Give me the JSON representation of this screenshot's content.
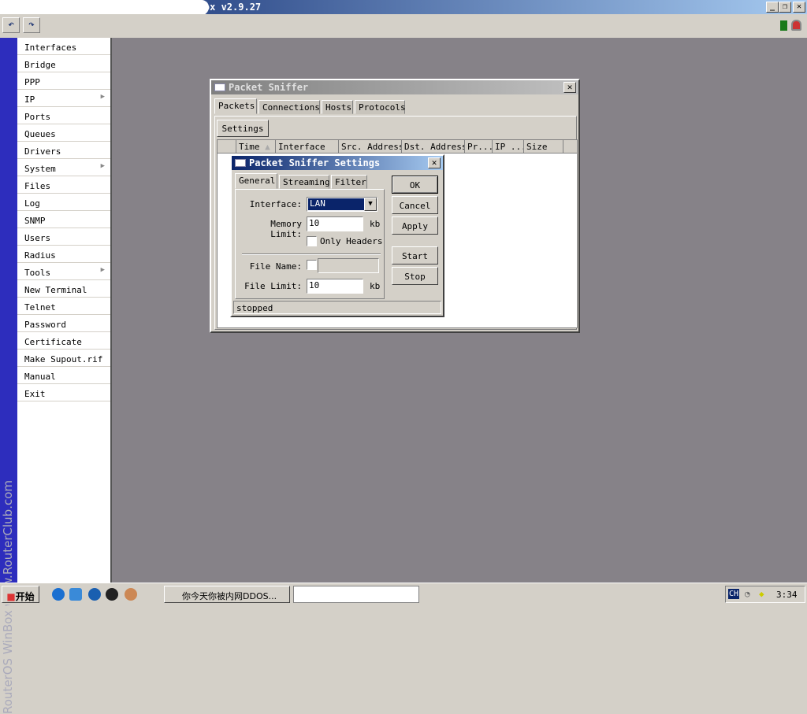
{
  "window": {
    "title": "WinBox v2.9.27"
  },
  "toolbar": {
    "undo": "undo-icon",
    "redo": "redo-icon"
  },
  "strip_text": "RouterOS WinBox   www.RouterClub.com",
  "sidebar": {
    "items": [
      {
        "label": "Interfaces"
      },
      {
        "label": "Bridge"
      },
      {
        "label": "PPP"
      },
      {
        "label": "IP",
        "submenu": true
      },
      {
        "label": "Ports"
      },
      {
        "label": "Queues"
      },
      {
        "label": "Drivers"
      },
      {
        "label": "System",
        "submenu": true
      },
      {
        "label": "Files"
      },
      {
        "label": "Log"
      },
      {
        "label": "SNMP"
      },
      {
        "label": "Users"
      },
      {
        "label": "Radius"
      },
      {
        "label": "Tools",
        "submenu": true
      },
      {
        "label": "New Terminal"
      },
      {
        "label": "Telnet"
      },
      {
        "label": "Password"
      },
      {
        "label": "Certificate"
      },
      {
        "label": "Make Supout.rif"
      },
      {
        "label": "Manual"
      },
      {
        "label": "Exit"
      }
    ]
  },
  "sniffer": {
    "title": "Packet Sniffer",
    "tabs": [
      "Packets",
      "Connections",
      "Hosts",
      "Protocols"
    ],
    "settings_button": "Settings",
    "columns": [
      "Time",
      "Interface",
      "Src. Address",
      "Dst. Address",
      "Pr...",
      "IP ...",
      "Size"
    ]
  },
  "settings": {
    "title": "Packet Sniffer Settings",
    "tabs": [
      "General",
      "Streaming",
      "Filter"
    ],
    "interface_label": "Interface:",
    "interface_value": "LAN",
    "memory_label": "Memory Limit:",
    "memory_value": "10",
    "memory_unit": "kb",
    "only_headers_label": "Only Headers",
    "only_headers_checked": false,
    "file_name_label": "File Name:",
    "file_name_value": "",
    "file_limit_label": "File Limit:",
    "file_limit_value": "10",
    "file_limit_unit": "kb",
    "buttons": {
      "ok": "OK",
      "cancel": "Cancel",
      "apply": "Apply",
      "start": "Start",
      "stop": "Stop"
    },
    "status": "stopped"
  },
  "taskbar": {
    "start": "开始",
    "task": "你今天你被内网DDOS...",
    "lang": "CH",
    "clock": "3:34"
  }
}
